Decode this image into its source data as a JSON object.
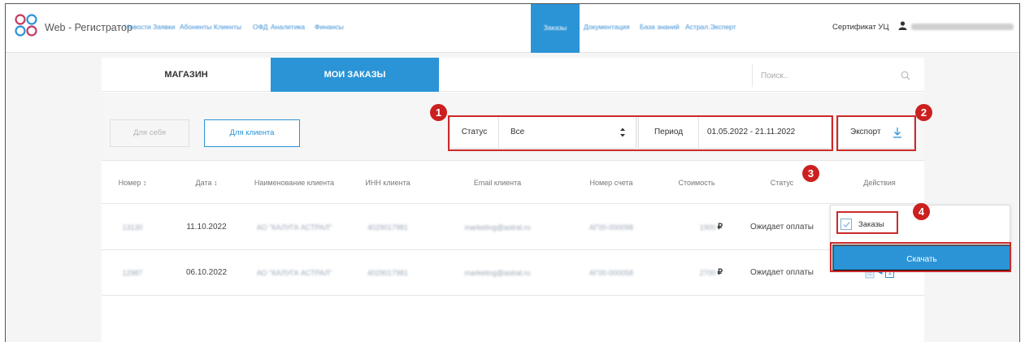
{
  "brand": "Web - Регистратор",
  "nav": {
    "items": [
      "Новости",
      "Заявки",
      "Абоненты",
      "Клиенты",
      "ОФД",
      "Аналитика",
      "Финансы",
      "Заказы",
      "Документация",
      "База знаний",
      "Астрал.Эксперт"
    ],
    "active_index": 7,
    "cert": "Сертификат УЦ",
    "user": ""
  },
  "tabs": {
    "shop": "МАГАЗИН",
    "orders": "МОИ ЗАКАЗЫ"
  },
  "search": {
    "placeholder": "Поиск.."
  },
  "filters": {
    "btn_self": "Для себя",
    "btn_client": "Для клиента",
    "status_label": "Статус",
    "status_value": "Все",
    "period_label": "Период",
    "period_value": "01.05.2022 - 21.11.2022",
    "export_label": "Экспорт"
  },
  "table": {
    "headers": [
      "Номер ↕",
      "Дата ↕",
      "Наименование клиента",
      "ИНН клиента",
      "Email клиента",
      "Номер счета",
      "Стоимость",
      "Статус",
      "Действия"
    ],
    "rows": [
      {
        "number": "13130",
        "date": "11.10.2022",
        "client": "АО \"КАЛУГА АСТРАЛ\"",
        "inn": "4029017981",
        "email": "marketing@astral.ru",
        "invoice": "АГ00-000098",
        "price": "1900",
        "currency": "₽",
        "status": "Ожидает оплаты",
        "qty": "1"
      },
      {
        "number": "12987",
        "date": "06.10.2022",
        "client": "АО \"КАЛУГА АСТРАЛ\"",
        "inn": "4029017981",
        "email": "marketing@astral.ru",
        "invoice": "АГ00-000058",
        "price": "2700",
        "currency": "₽",
        "status": "Ожидает оплаты",
        "qty": "1"
      }
    ]
  },
  "dropdown": {
    "checkbox_label": "Заказы",
    "download_label": "Скачать"
  },
  "badges": [
    "1",
    "2",
    "3",
    "4"
  ],
  "colors": {
    "accent": "#2b94d6",
    "annotation": "#cc1f1f"
  }
}
